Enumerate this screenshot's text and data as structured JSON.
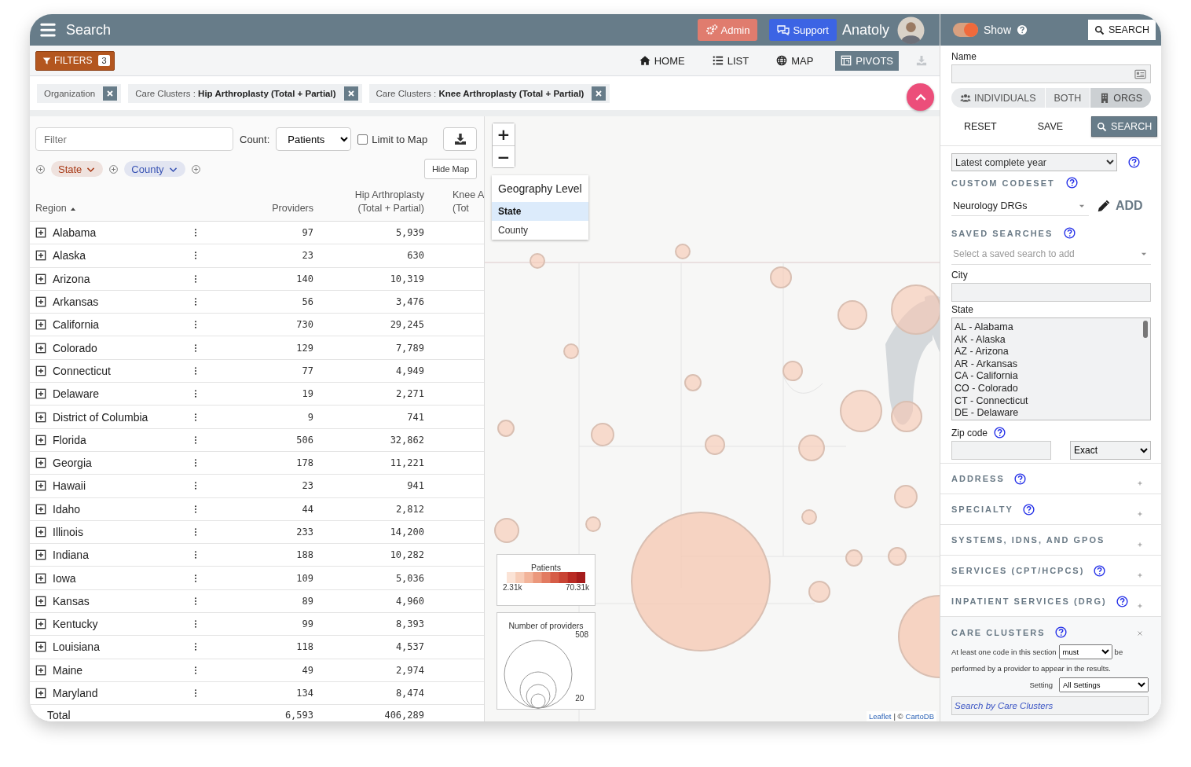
{
  "topbar": {
    "title": "Search",
    "admin": "Admin",
    "support": "Support",
    "user": "Anatoly"
  },
  "right_topbar": {
    "show_toggle": {
      "label": "Show",
      "on": true
    },
    "search_button": "SEARCH"
  },
  "filters_button": {
    "label": "FILTERS",
    "count": "3"
  },
  "nav": [
    {
      "label": "HOME",
      "kind": "home",
      "selected": false
    },
    {
      "label": "LIST",
      "kind": "list",
      "selected": false
    },
    {
      "label": "MAP",
      "kind": "globe",
      "selected": false
    },
    {
      "label": "PIVOTS",
      "kind": "pivot",
      "selected": true
    }
  ],
  "nav_download": {
    "disabled": true
  },
  "active_filters": [
    {
      "label": "Organization"
    },
    {
      "label": "Care Clusters : **Hip Arthroplasty (Total + Partial)**"
    },
    {
      "label": "Care Clusters : **Knee Arthroplasty (Total + Partial)**"
    }
  ],
  "table_panel": {
    "filter_placeholder": "Filter",
    "count_label": "Count:",
    "count_value": "Patients",
    "limit_to_map": {
      "label": "Limit to Map",
      "checked": false
    },
    "group_chips": [
      {
        "label": "State",
        "color": "#a83a17"
      },
      {
        "label": "County",
        "color": "#3a54b4"
      }
    ],
    "hide_map": "Hide Map"
  },
  "table": {
    "columns": [
      {
        "lines": [
          "Region"
        ],
        "sorted": true
      },
      {
        "lines": [
          "Providers"
        ],
        "sorted": false
      },
      {
        "lines": [
          "Hip Arthroplasty",
          "(Total + Partial)"
        ],
        "sorted": false
      },
      {
        "lines": [
          "Knee A",
          "(Tot"
        ],
        "sorted": false
      }
    ],
    "rows": [
      {
        "region": "Alabama",
        "providers": "97",
        "hip": "5,939"
      },
      {
        "region": "Alaska",
        "providers": "23",
        "hip": "630"
      },
      {
        "region": "Arizona",
        "providers": "140",
        "hip": "10,319"
      },
      {
        "region": "Arkansas",
        "providers": "56",
        "hip": "3,476"
      },
      {
        "region": "California",
        "providers": "730",
        "hip": "29,245"
      },
      {
        "region": "Colorado",
        "providers": "129",
        "hip": "7,789"
      },
      {
        "region": "Connecticut",
        "providers": "77",
        "hip": "4,949"
      },
      {
        "region": "Delaware",
        "providers": "19",
        "hip": "2,271"
      },
      {
        "region": "District of Columbia",
        "providers": "9",
        "hip": "741"
      },
      {
        "region": "Florida",
        "providers": "506",
        "hip": "32,862"
      },
      {
        "region": "Georgia",
        "providers": "178",
        "hip": "11,221"
      },
      {
        "region": "Hawaii",
        "providers": "23",
        "hip": "941"
      },
      {
        "region": "Idaho",
        "providers": "44",
        "hip": "2,812"
      },
      {
        "region": "Illinois",
        "providers": "233",
        "hip": "14,200"
      },
      {
        "region": "Indiana",
        "providers": "188",
        "hip": "10,282"
      },
      {
        "region": "Iowa",
        "providers": "109",
        "hip": "5,036"
      },
      {
        "region": "Kansas",
        "providers": "89",
        "hip": "4,960"
      },
      {
        "region": "Kentucky",
        "providers": "99",
        "hip": "8,393"
      },
      {
        "region": "Louisiana",
        "providers": "118",
        "hip": "4,537"
      },
      {
        "region": "Maine",
        "providers": "49",
        "hip": "2,974"
      },
      {
        "region": "Maryland",
        "providers": "134",
        "hip": "8,474"
      }
    ],
    "total": {
      "region": "Total",
      "providers": "6,593",
      "hip": "406,289"
    }
  },
  "map": {
    "zoom_in": "+",
    "zoom_out": "−",
    "geography": {
      "title": "Geography Level",
      "options": [
        {
          "label": "State",
          "selected": true
        },
        {
          "label": "County",
          "selected": false
        }
      ]
    },
    "legend_color": {
      "title": "Patients",
      "min": "2.31k",
      "max": "70.31k"
    },
    "legend_size": {
      "title": "Number of providers",
      "max": "508",
      "min": "20"
    },
    "attribution": {
      "first": "Leaflet",
      "separator": "| ©",
      "second": "CartoDB"
    }
  },
  "side": {
    "name_label": "Name",
    "entity_toggle": [
      {
        "label": "INDIVIDUALS",
        "kind": "people",
        "selected": false
      },
      {
        "label": "BOTH",
        "kind": "none",
        "selected": false
      },
      {
        "label": "ORGS",
        "kind": "building",
        "selected": true
      }
    ],
    "actions": [
      "RESET",
      "SAVE"
    ],
    "search_button": "SEARCH",
    "period": "Latest complete year",
    "codeset": {
      "title": "CUSTOM CODESET",
      "value": "Neurology DRGs",
      "add": "ADD"
    },
    "saved": {
      "title": "SAVED SEARCHES",
      "placeholder": "Select a saved search to add"
    },
    "city_label": "City",
    "state": {
      "label": "State",
      "options": [
        "AL - Alabama",
        "AK - Alaska",
        "AZ - Arizona",
        "AR - Arkansas",
        "CA - California",
        "CO - Colorado",
        "CT - Connecticut",
        "DE - Delaware"
      ]
    },
    "zip": {
      "label": "Zip code",
      "match": "Exact"
    },
    "sections": [
      {
        "title": "ADDRESS",
        "help": true,
        "expanded": false
      },
      {
        "title": "SPECIALTY",
        "help": true,
        "expanded": false
      },
      {
        "title": "SYSTEMS, IDNS, AND GPOS",
        "help": false,
        "expanded": false
      },
      {
        "title": "SERVICES (CPT/HCPCS)",
        "help": true,
        "expanded": false
      },
      {
        "title": "INPATIENT SERVICES (DRG)",
        "help": true,
        "expanded": false
      },
      {
        "title": "CARE CLUSTERS",
        "help": true,
        "expanded": true
      }
    ],
    "care_clusters": {
      "text_before": "At least one code in this section",
      "mode": "must",
      "text_after": "be",
      "text_line2": "performed by a provider to appear in the results.",
      "setting_label": "Setting",
      "setting": "All Settings",
      "placeholder": "Search by Care Clusters"
    }
  }
}
